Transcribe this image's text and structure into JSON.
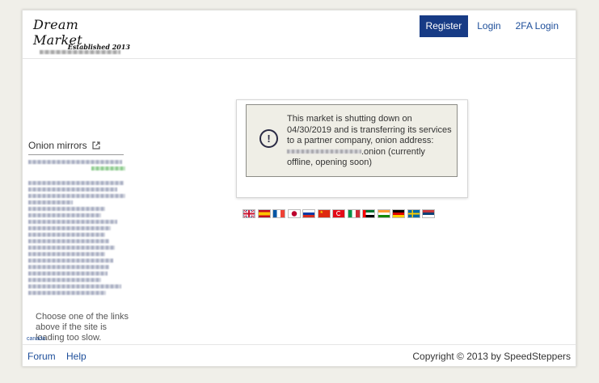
{
  "header": {
    "logo_title": "Dream Market",
    "logo_subtitle": "Established 2013",
    "nav": {
      "register": "Register",
      "login": "Login",
      "twofa_login": "2FA Login"
    }
  },
  "sidebar": {
    "mirrors_title": "Onion mirrors",
    "hint": "Choose one of the links above if the site is loading too slow.",
    "small_link": "canada"
  },
  "notice": {
    "line_before_address": "This market is shutting down on 04/30/2019 and is transferring its services to a partner company, onion address:",
    "address_suffix": ".onion",
    "line_after_address": "(currently offline, opening soon)"
  },
  "flags": [
    {
      "icon": "uk-flag-icon"
    },
    {
      "icon": "spain-flag-icon"
    },
    {
      "icon": "france-flag-icon"
    },
    {
      "icon": "japan-flag-icon"
    },
    {
      "icon": "russia-flag-icon"
    },
    {
      "icon": "china-flag-icon"
    },
    {
      "icon": "turkey-flag-icon"
    },
    {
      "icon": "italy-flag-icon"
    },
    {
      "icon": "uae-flag-icon"
    },
    {
      "icon": "india-flag-icon"
    },
    {
      "icon": "germany-flag-icon"
    },
    {
      "icon": "sweden-flag-icon"
    },
    {
      "icon": "serbia-flag-icon"
    }
  ],
  "footer": {
    "forum": "Forum",
    "help": "Help",
    "copyright": "Copyright © 2013 by SpeedSteppers"
  },
  "colors": {
    "accent": "#173b85",
    "link": "#1d4e9a",
    "alert_bg": "#efeee6"
  }
}
